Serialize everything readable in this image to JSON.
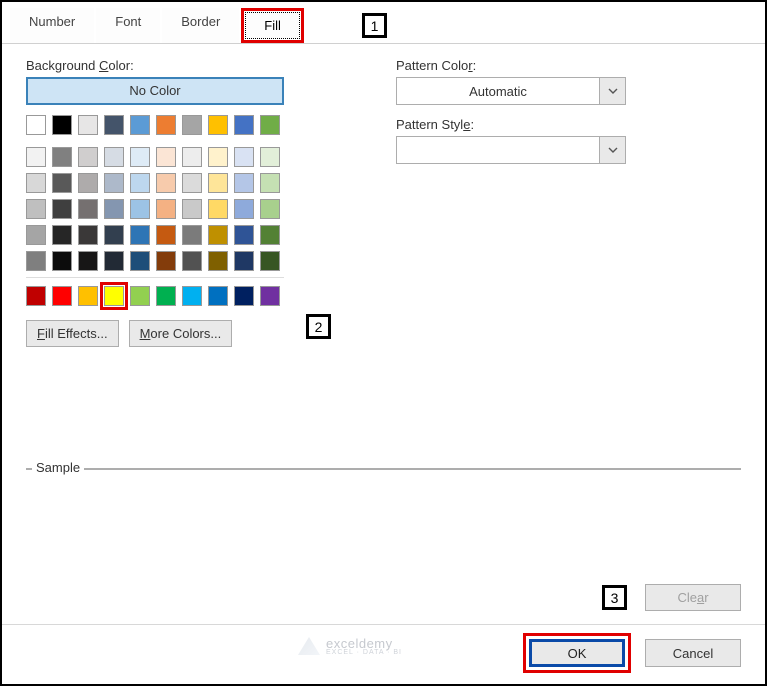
{
  "tabs": {
    "number": "Number",
    "font": "Font",
    "border": "Border",
    "fill": "Fill"
  },
  "callouts": {
    "c1": "1",
    "c2": "2",
    "c3": "3"
  },
  "labels": {
    "bgcolor_pre": "Background ",
    "bgcolor_u": "C",
    "bgcolor_post": "olor:",
    "nocolor": "No Color",
    "patcolor_pre": "Pattern Colo",
    "patcolor_u": "r",
    "patcolor_post": ":",
    "patstyle_pre": "Pattern Styl",
    "patstyle_u": "e",
    "patstyle_post": ":",
    "fe_u": "F",
    "fe_post": "ill Effects...",
    "mc_u": "M",
    "mc_post": "ore Colors...",
    "sample": "Sample",
    "clear_pre": "Cle",
    "clear_u": "a",
    "clear_post": "r",
    "ok": "OK",
    "cancel": "Cancel"
  },
  "pattern_color_value": "Automatic",
  "pattern_style_value": "",
  "watermark": {
    "brand": "exceldemy",
    "sub": "EXCEL · DATA · BI"
  },
  "palette_row1": [
    "#ffffff",
    "#000000",
    "#e7e6e6",
    "#44546a",
    "#5b9bd5",
    "#ed7d31",
    "#a5a5a5",
    "#ffc000",
    "#4472c4",
    "#70ad47"
  ],
  "palette_grid": [
    [
      "#f2f2f2",
      "#808080",
      "#d0cece",
      "#d6dce4",
      "#deebf6",
      "#fbe5d5",
      "#ededed",
      "#fff2cc",
      "#d9e2f3",
      "#e2efd9"
    ],
    [
      "#d8d8d8",
      "#595959",
      "#aeabab",
      "#adb9ca",
      "#bdd7ee",
      "#f7cbac",
      "#dbdbdb",
      "#fee599",
      "#b4c6e7",
      "#c5e0b3"
    ],
    [
      "#bfbfbf",
      "#3f3f3f",
      "#757070",
      "#8496b0",
      "#9cc3e5",
      "#f4b183",
      "#c9c9c9",
      "#ffd965",
      "#8eaadb",
      "#a8d08d"
    ],
    [
      "#a5a5a5",
      "#262626",
      "#3a3838",
      "#323f4f",
      "#2e75b5",
      "#c55a11",
      "#7b7b7b",
      "#bf9000",
      "#2f5496",
      "#538135"
    ],
    [
      "#7f7f7f",
      "#0c0c0c",
      "#171616",
      "#222a35",
      "#1e4e79",
      "#833c0b",
      "#525252",
      "#7f6000",
      "#1f3864",
      "#375623"
    ]
  ],
  "palette_standard": [
    "#c00000",
    "#ff0000",
    "#ffc000",
    "#ffff00",
    "#92d050",
    "#00b050",
    "#00b0f0",
    "#0070c0",
    "#002060",
    "#7030a0"
  ],
  "selected_swatch_index": 3
}
